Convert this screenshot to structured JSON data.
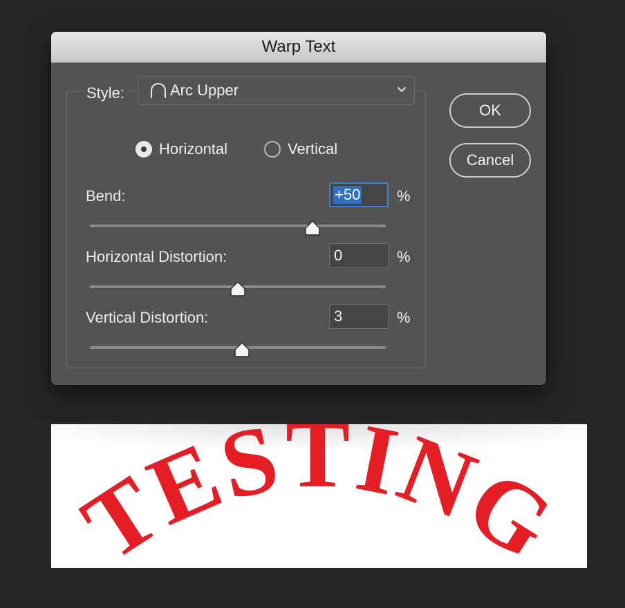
{
  "dialog": {
    "title": "Warp Text",
    "style_label": "Style:",
    "style_value": "Arc Upper",
    "style_icon": "arc-upper-icon",
    "orientation": {
      "options": [
        "Horizontal",
        "Vertical"
      ],
      "selected": "Horizontal"
    },
    "bend": {
      "label": "Bend:",
      "value": "+50",
      "unit": "%",
      "slider_value": 50
    },
    "horizontal_distortion": {
      "label": "Horizontal Distortion:",
      "value": "0",
      "unit": "%",
      "slider_value": 0
    },
    "vertical_distortion": {
      "label": "Vertical Distortion:",
      "value": "3",
      "unit": "%",
      "slider_value": 3
    },
    "buttons": {
      "ok": "OK",
      "cancel": "Cancel"
    }
  },
  "preview": {
    "text": "TESTING",
    "text_color": "#e51e25"
  }
}
